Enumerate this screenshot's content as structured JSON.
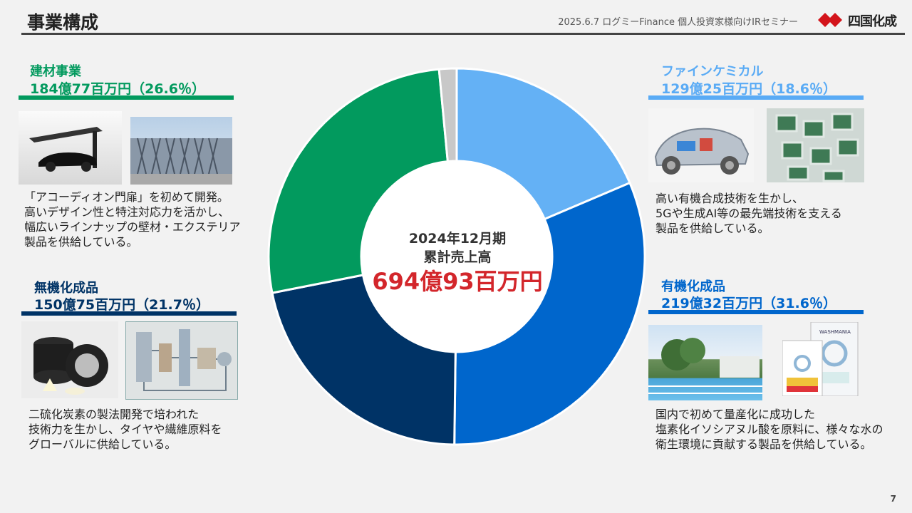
{
  "header": {
    "title": "事業構成",
    "event": "2025.6.7 ログミーFinance 個人投資家様向けIRセミナー",
    "logo_text": "四国化成"
  },
  "center": {
    "period": "2024年12月期",
    "label": "累計売上高",
    "total": "694億93百万円"
  },
  "segments": {
    "kenzai": {
      "name": "建材事業",
      "value": "184億77百万円（26.6％）",
      "color": "#029a5e",
      "desc": [
        "「アコーディオン門扉」を初めて開発。",
        "高いデザイン性と特注対応力を活かし、",
        "幅広いラインナップの壁材・エクステリア",
        "製品を供給している。"
      ]
    },
    "fine": {
      "name": "ファインケミカル",
      "value": "129億25百万円（18.6％）",
      "color": "#5aabf5",
      "desc": [
        "高い有機合成技術を生かし、",
        "5Gや生成AI等の最先端技術を支える",
        "製品を供給している。"
      ]
    },
    "muki": {
      "name": "無機化成品",
      "value": "150億75百万円（21.7％）",
      "color": "#003366",
      "desc": [
        "二硫化炭素の製法開発で培われた",
        "技術力を生かし、タイヤや繊維原料を",
        "グローバルに供給している。"
      ]
    },
    "yuki": {
      "name": "有機化成品",
      "value": "219億32百万円（31.6％）",
      "color": "#0066cc",
      "desc": [
        "国内で初めて量産化に成功した",
        "塩素化イソシアヌル酸を原料に、様々な水の",
        "衛生環境に貢献する製品を供給している。"
      ]
    }
  },
  "chart_data": {
    "type": "pie",
    "style": "donut",
    "start": "top, clockwise",
    "categories": [
      "ファインケミカル",
      "有機化成品",
      "無機化成品",
      "建材事業",
      "その他"
    ],
    "values": [
      18.6,
      31.6,
      21.7,
      26.6,
      1.5
    ],
    "colors": [
      "#64b1f5",
      "#0066cc",
      "#003366",
      "#029a5e",
      "#c8c8c8"
    ]
  },
  "product_images": {
    "washmania_label": "WASHMANIA"
  },
  "page_number": "7"
}
